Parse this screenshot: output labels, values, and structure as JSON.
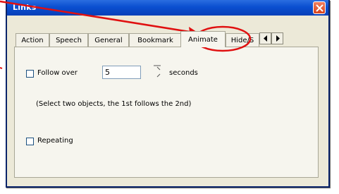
{
  "window": {
    "title": "Links"
  },
  "tabs": [
    {
      "label": "Action",
      "active": false
    },
    {
      "label": "Speech",
      "active": false
    },
    {
      "label": "General",
      "active": false
    },
    {
      "label": "Bookmark",
      "active": false
    },
    {
      "label": "Animate",
      "active": true
    },
    {
      "label": "Hide/S",
      "active": false
    }
  ],
  "animate_panel": {
    "follow_over_label": "Follow over",
    "follow_over_value": "5",
    "seconds_label": "seconds",
    "instruction": "(Select two objects, the 1st follows the 2nd)",
    "repeating_label": "Repeating",
    "follow_over_checked": false,
    "repeating_checked": false
  },
  "annotation": {
    "arrow_color": "#e01010",
    "ellipse_color": "#e01010"
  }
}
